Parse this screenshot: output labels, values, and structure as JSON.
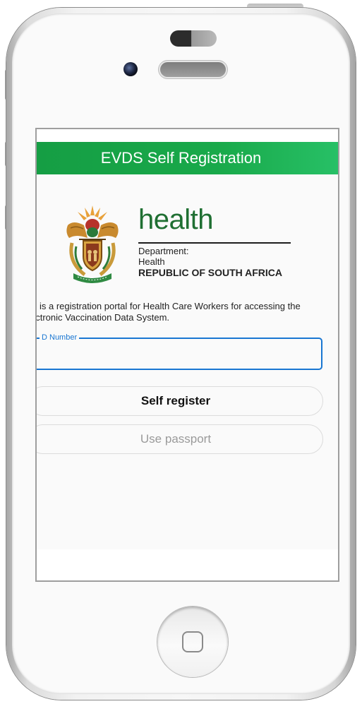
{
  "header": {
    "title": "EVDS Self Registration"
  },
  "branding": {
    "word": "health",
    "department_label": "Department:",
    "department_name": "Health",
    "country": "REPUBLIC OF SOUTH AFRICA"
  },
  "intro": {
    "line1": "is is a registration portal for Health Care Workers for accessing the",
    "line2": "ectronic Vaccination Data System."
  },
  "id_field": {
    "label": "D Number",
    "value": ""
  },
  "buttons": {
    "self_register": "Self register",
    "use_passport": "Use passport"
  },
  "colors": {
    "header_green": "#19a94a",
    "brand_green": "#1f6f32",
    "input_blue": "#1976d2"
  }
}
